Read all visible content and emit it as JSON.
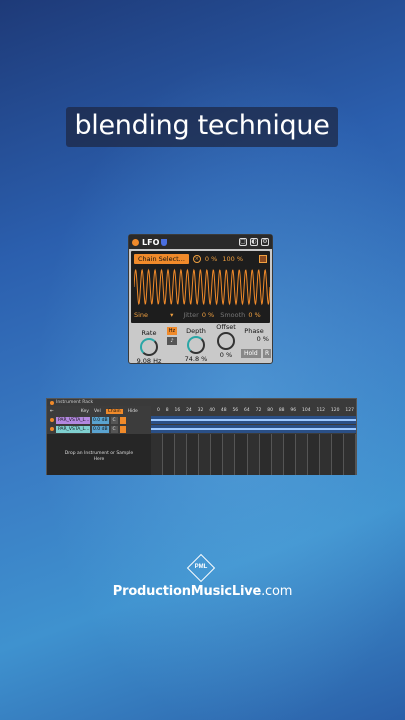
{
  "caption": "blending technique",
  "lfo": {
    "title": "LFO",
    "chain_select": "Chain Select...",
    "amount_pct": "0 %",
    "scale_pct": "100 %",
    "waveform": "Sine",
    "jitter_label": "Jitter",
    "jitter_value": "0 %",
    "smooth_label": "Smooth",
    "smooth_value": "0 %",
    "rate_label": "Rate",
    "rate_value": "9.08 Hz",
    "hz_btn": "Hz",
    "note_btn": "♪",
    "depth_label": "Depth",
    "depth_value": "74.8 %",
    "offset_label": "Offset",
    "offset_value": "0 %",
    "phase_label": "Phase",
    "phase_value": "0 %",
    "hold_btn": "Hold",
    "r_btn": "R"
  },
  "rack": {
    "title": "Instrument Rack",
    "toolbar": [
      "Key",
      "Vel",
      "Chain",
      "Hide"
    ],
    "chains": [
      {
        "name": "PAR_VSTA_L...",
        "vol": "0.0 dB",
        "pan": "C",
        "color": "#b388e0"
      },
      {
        "name": "PAR_VSTA_L...",
        "vol": "0.0 dB",
        "pan": "C",
        "color": "#7fd0d0"
      }
    ],
    "drop_text_1": "Drop an Instrument or Sample",
    "drop_text_2": "Here",
    "ruler": [
      "0",
      "8",
      "16",
      "24",
      "32",
      "40",
      "48",
      "56",
      "64",
      "72",
      "80",
      "88",
      "96",
      "104",
      "112",
      "120",
      "127"
    ]
  },
  "brand": {
    "mark": "PML",
    "name_bold": "ProductionMusicLive",
    "name_suffix": ".com"
  }
}
